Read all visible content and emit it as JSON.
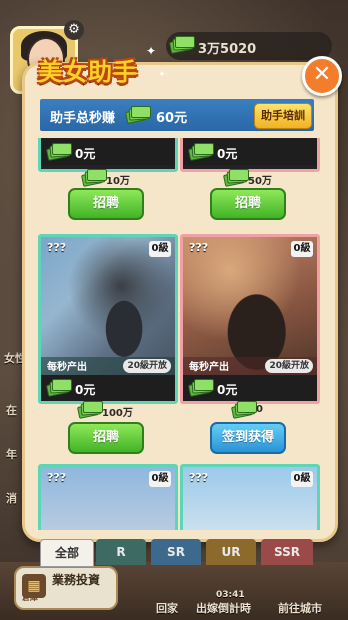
{
  "header": {
    "money_total": "3万5020"
  },
  "side_labels": [
    "女性",
    "在",
    "年",
    "消"
  ],
  "bottom_nav": {
    "invest_label": "業務投資",
    "invest_sub": "倉庫",
    "home_label": "回家",
    "countdown_label": "出嫁倒計時",
    "countdown_time": "03:41",
    "city_label": "前往城市"
  },
  "modal": {
    "title": "美女助手",
    "banner_label": "助手总秒赚",
    "banner_value": "60元",
    "train_button": "助手培訓"
  },
  "cards": [
    {
      "earn": "0元"
    },
    {
      "earn": "0元"
    },
    {
      "qqq": "???",
      "level": "0級",
      "rate_label": "每秒产出",
      "open_tag": "20級开放",
      "earn": "0元"
    },
    {
      "qqq": "???",
      "level": "0級",
      "rate_label": "每秒产出",
      "open_tag": "20級开放",
      "earn": "0元"
    },
    {
      "qqq": "???",
      "level": "0級"
    },
    {
      "qqq": "???",
      "level": "0級"
    }
  ],
  "costs": [
    "10万",
    "50万",
    "100万",
    "0"
  ],
  "buttons": {
    "hire": "招聘",
    "sign_in": "签到获得"
  },
  "tabs": [
    "全部",
    "R",
    "SR",
    "UR",
    "SSR"
  ],
  "colors": {
    "title_gold": "#ffd028",
    "banner_blue": "#2a67a6",
    "hire_green": "#42b326",
    "sign_blue": "#2a93d6",
    "card_teal": "#5fd5b8",
    "card_pink": "#f2a0a6"
  }
}
